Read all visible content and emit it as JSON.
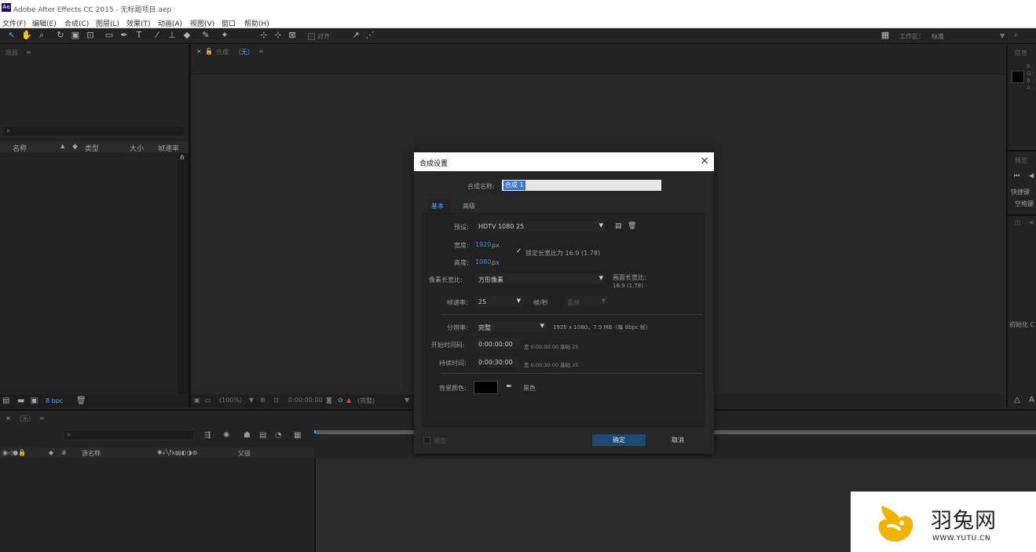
{
  "window": {
    "title": "Adobe After Effects CC 2015 - 无标题项目.aep",
    "logo": "Ae"
  },
  "menu": [
    "文件(F)",
    "编辑(E)",
    "合成(C)",
    "图层(L)",
    "效果(T)",
    "动画(A)",
    "视图(V)",
    "窗口",
    "帮助(H)"
  ],
  "toolbar": {
    "snap_label": "对齐",
    "workspace_label": "工作区：",
    "workspace_value": "标准"
  },
  "project_panel": {
    "tab": "项目",
    "columns": [
      "名称",
      "类型",
      "大小",
      "帧速率"
    ],
    "bpc": "8 bpc"
  },
  "viewer": {
    "tab_label": "合成",
    "tab_comp": "（无）",
    "zoom": "(100%)",
    "timecode": "0:00:00:00",
    "resolution": "(完整)"
  },
  "right_panels": {
    "info_tab": "信息",
    "info_channels": [
      "R :",
      "G :",
      "B :",
      "A :"
    ],
    "preview_tab": "预览",
    "shortcut": "快捷键",
    "spacebar": "空格键",
    "initialize": "初始化 C"
  },
  "timeline": {
    "tab": "（无）",
    "cols": {
      "source_name": "源名称",
      "parent": "父级"
    }
  },
  "dialog": {
    "title": "合成设置",
    "name_label": "合成名称:",
    "name_value": "合成 1",
    "tabs": {
      "basic": "基本",
      "advanced": "高级"
    },
    "preset_label": "预设:",
    "preset_value": "HDTV 1080 25",
    "width_label": "宽度:",
    "width_value": "1920",
    "height_label": "高度:",
    "height_value": "1080",
    "px": "px",
    "lock_label": "锁定长宽比为 16:9 (1.78)",
    "par_label": "像素长宽比:",
    "par_value": "方形像素",
    "frame_aspect_label": "画面长宽比:",
    "frame_aspect_value": "16:9 (1.78)",
    "fps_label": "帧速率:",
    "fps_value": "25",
    "fps_unit": "帧/秒",
    "drop_frame": "丢帧",
    "resolution_label": "分辨率:",
    "resolution_value": "完整",
    "resolution_info": "1920 x 1080，7.9 MB（每 8bpc 帧）",
    "start_tc_label": "开始时间码:",
    "start_tc_value": "0:00:00:00",
    "start_tc_info": "是 0:00:00:00  基础 25",
    "duration_label": "持续时间:",
    "duration_value": "0:00:30:00",
    "duration_info": "是 0:00:30:00  基础 25",
    "bg_label": "背景颜色:",
    "bg_color_name": "黑色",
    "bg_color": "#000000",
    "preview_label": "预览",
    "ok": "确定",
    "cancel": "取消"
  },
  "watermark": {
    "brand": "羽兔网",
    "url": "WWW.YUTU.CN"
  },
  "colors": {
    "accent_blue": "#3a8ee6",
    "ok_button": "#1d4a73",
    "watermark_logo": "#f0b400"
  }
}
